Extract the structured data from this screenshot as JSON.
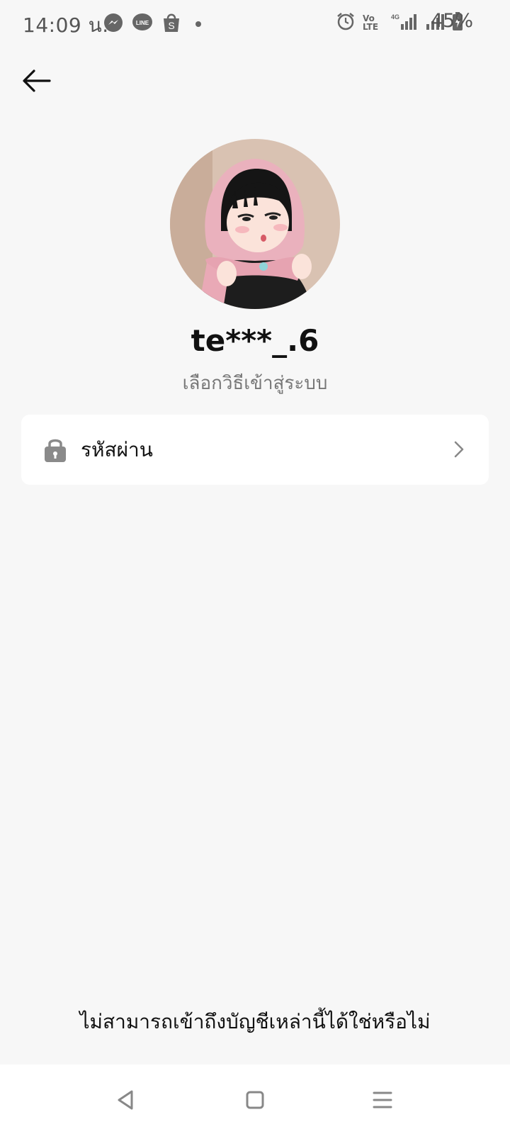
{
  "status_bar": {
    "time": "14:09 น.",
    "battery": "45%",
    "notification_icons": [
      "messenger-icon",
      "line-icon",
      "shopee-icon",
      "more-dot-icon"
    ],
    "system_icons": [
      "alarm-icon",
      "volte-icon",
      "4g-signal-icon",
      "signal-icon",
      "battery-icon"
    ],
    "volte_text": "Vo LTE"
  },
  "profile": {
    "username": "te***_.6",
    "subtitle": "เลือกวิธีเข้าสู่ระบบ"
  },
  "login_options": [
    {
      "label": "รหัสผ่าน",
      "icon": "lock-icon"
    }
  ],
  "footer": {
    "help_link": "ไม่สามารถเข้าถึงบัญชีเหล่านี้ได้ใช่หรือไม่"
  },
  "colors": {
    "background": "#f7f7f7",
    "card": "#ffffff",
    "primary_text": "#111111",
    "secondary_text": "#777777",
    "icon_gray": "#8a8a8a"
  }
}
